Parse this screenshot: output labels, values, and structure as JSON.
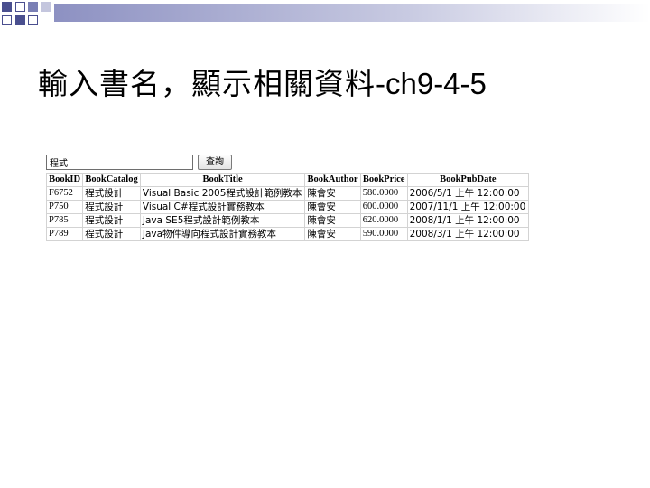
{
  "slide": {
    "title": "輸入書名，顯示相關資料",
    "title_suffix": "-ch9-4-5"
  },
  "search": {
    "value": "程式",
    "button_label": "查詢"
  },
  "table": {
    "headers": [
      "BookID",
      "BookCatalog",
      "BookTitle",
      "BookAuthor",
      "BookPrice",
      "BookPubDate"
    ],
    "rows": [
      [
        "F6752",
        "程式設計",
        "Visual Basic 2005程式設計範例教本",
        "陳會安",
        "580.0000",
        "2006/5/1 上午 12:00:00"
      ],
      [
        "P750",
        "程式設計",
        "Visual C#程式設計實務教本",
        "陳會安",
        "600.0000",
        "2007/11/1 上午 12:00:00"
      ],
      [
        "P785",
        "程式設計",
        "Java SE5程式設計範例教本",
        "陳會安",
        "620.0000",
        "2008/1/1 上午 12:00:00"
      ],
      [
        "P789",
        "程式設計",
        "Java物件導向程式設計實務教本",
        "陳會安",
        "590.0000",
        "2008/3/1 上午 12:00:00"
      ]
    ]
  },
  "colors": {
    "accent": "#4a4f8f",
    "grid": "#d3d3d3"
  }
}
